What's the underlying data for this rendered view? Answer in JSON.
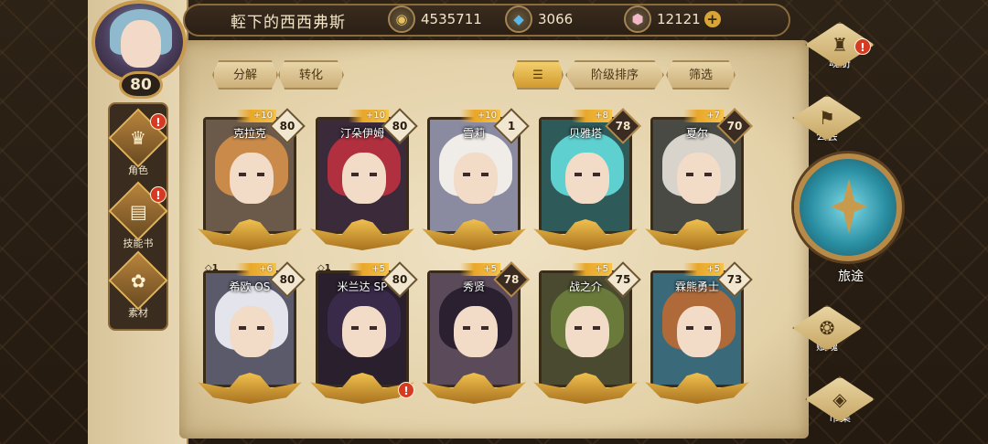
{
  "header": {
    "player_name": "䡖下的西西弗斯",
    "player_level": "80",
    "resources": [
      {
        "icon": "gold-coin-icon",
        "value": "4535711"
      },
      {
        "icon": "blue-crystal-icon",
        "value": "3066"
      },
      {
        "icon": "pink-gem-icon",
        "value": "12121"
      }
    ]
  },
  "left_nav": {
    "items": [
      {
        "label": "角色",
        "icon": "character-icon",
        "alert": "!"
      },
      {
        "label": "技能书",
        "icon": "skill-book-icon",
        "alert": "!"
      },
      {
        "label": "素材",
        "icon": "materials-icon"
      }
    ]
  },
  "toolbar": {
    "decompose": "分解",
    "convert": "转化",
    "sort_rank": "阶级排序",
    "filter": "筛选"
  },
  "cards": [
    {
      "name": "克拉克",
      "level": "80",
      "bonus": "+10",
      "dark": false,
      "hair": "#c98a4a",
      "bg": "#6b5a4a"
    },
    {
      "name": "汀朵伊姆",
      "level": "80",
      "bonus": "+10",
      "dark": false,
      "hair": "#b03040",
      "bg": "#3b2a3a"
    },
    {
      "name": "雪莉",
      "level": "1",
      "bonus": "+10",
      "dark": false,
      "hair": "#f0ece8",
      "bg": "#8a8aa0"
    },
    {
      "name": "贝雅塔",
      "level": "78",
      "bonus": "+8",
      "dark": true,
      "hair": "#5fd0d0",
      "bg": "#2f5a5a"
    },
    {
      "name": "夏尔",
      "level": "70",
      "bonus": "+7",
      "dark": true,
      "hair": "#d8d4cc",
      "bg": "#4a4a44"
    },
    {
      "name": "希欧 OS",
      "level": "80",
      "bonus": "+6",
      "dup": "◇1",
      "dark": false,
      "hair": "#e4e4ec",
      "bg": "#5a5a6a"
    },
    {
      "name": "米兰达 SP",
      "level": "80",
      "bonus": "+5",
      "dup": "◇1",
      "dark": false,
      "hair": "#3a2a4a",
      "bg": "#2a1f2c",
      "alert": "!"
    },
    {
      "name": "秀贤",
      "level": "78",
      "bonus": "+5",
      "dark": true,
      "hair": "#2a2030",
      "bg": "#5a4a5a"
    },
    {
      "name": "战之介",
      "level": "75",
      "bonus": "+5",
      "dark": false,
      "hair": "#6a7a3a",
      "bg": "#4a4a30"
    },
    {
      "name": "霖熊勇士",
      "level": "73",
      "bonus": "+5",
      "dark": false,
      "hair": "#b06a3a",
      "bg": "#3a6a7a"
    }
  ],
  "right_nav": {
    "items": [
      {
        "label": "魂册",
        "icon": "soul-book-icon",
        "alert": "!"
      },
      {
        "label": "公会",
        "icon": "guild-icon"
      },
      {
        "label": "赋魂",
        "icon": "soul-infuse-icon"
      },
      {
        "label": "市集",
        "icon": "market-icon"
      }
    ],
    "journey": "旅途"
  },
  "colors": {
    "accent_gold": "#d9a536",
    "alert_red": "#d63a22",
    "parchment": "#e9d9b5"
  }
}
